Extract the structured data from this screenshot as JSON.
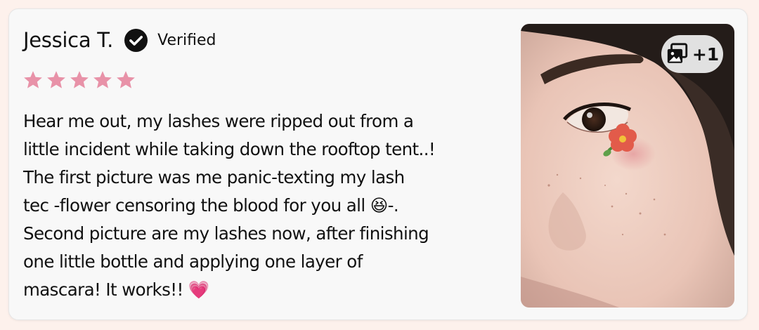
{
  "review": {
    "reviewer_name": "Jessica T.",
    "verified_label": "Verified",
    "rating": 5,
    "rating_max": 5,
    "star_color": "#e892a8",
    "body_lines": [
      "Hear me out, my lashes were ripped out from a",
      "little incident while taking down the rooftop tent..!",
      "The first picture was me panic-texting my lash",
      "tec -flower censoring the blood for you all 😆-.",
      "Second picture are my lashes now, after finishing",
      "one little bottle and applying one layer of",
      "mascara! It works!! 💗"
    ],
    "photo": {
      "description_icon": "gallery-icon",
      "more_count_label": "+1"
    }
  }
}
